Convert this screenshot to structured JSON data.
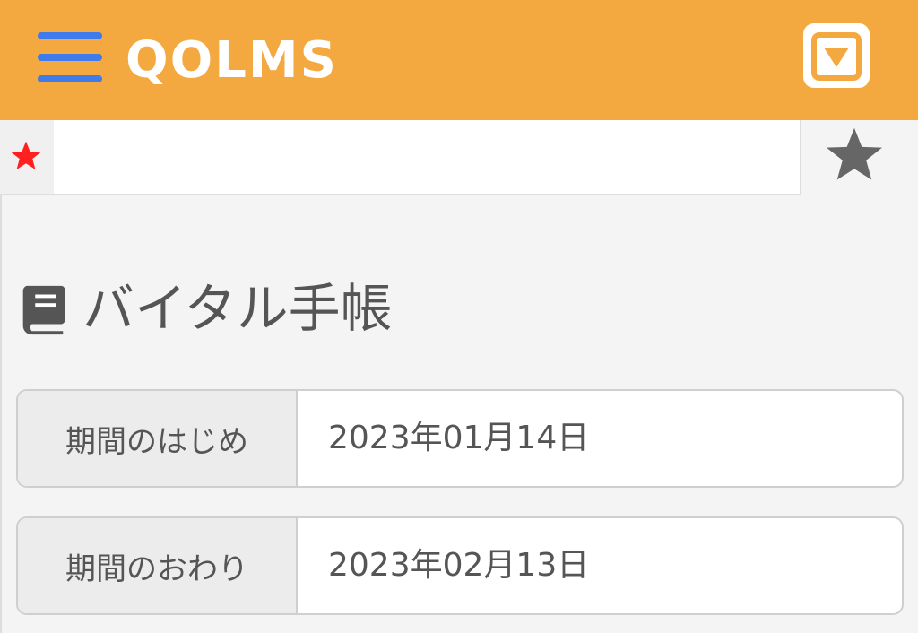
{
  "header": {
    "logo_text": "QOLMS",
    "menu_icon": "hamburger-menu-icon",
    "dropdown_icon": "dropdown-triangle-icon",
    "background_color": "#f3a93f",
    "menu_color": "#3f7bea"
  },
  "favorites": {
    "marker_icon": "red-star-icon",
    "marker_color": "#ff2020",
    "toggle_icon": "star-icon",
    "toggle_color": "#666666"
  },
  "page": {
    "icon": "book-icon",
    "title": "バイタル手帳"
  },
  "period": {
    "start_label": "期間のはじめ",
    "start_value": "2023年01月14日",
    "end_label": "期間のおわり",
    "end_value": "2023年02月13日"
  }
}
